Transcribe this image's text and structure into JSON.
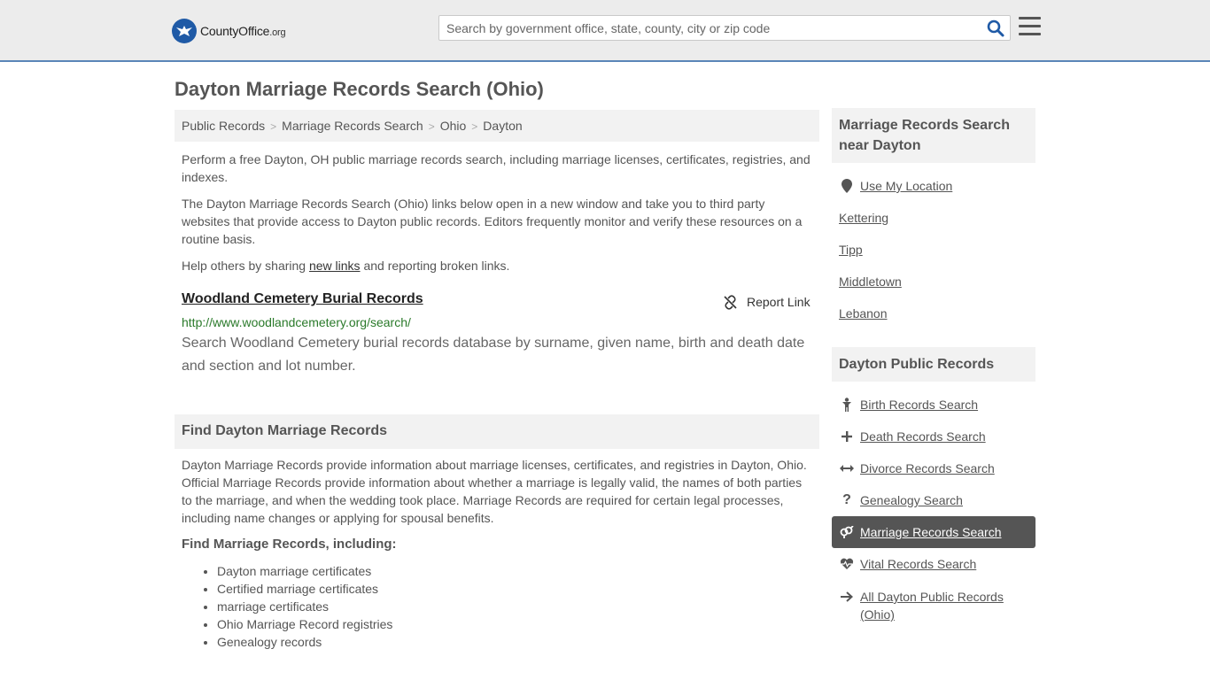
{
  "header": {
    "logo_text": "CountyOffice",
    "logo_org": ".org",
    "search_placeholder": "Search by government office, state, county, city or zip code"
  },
  "page_title": "Dayton Marriage Records Search (Ohio)",
  "breadcrumb": [
    "Public Records",
    "Marriage Records Search",
    "Ohio",
    "Dayton"
  ],
  "intro": {
    "p1": "Perform a free Dayton, OH public marriage records search, including marriage licenses, certificates, registries, and indexes.",
    "p2": "The Dayton Marriage Records Search (Ohio) links below open in a new window and take you to third party websites that provide access to Dayton public records. Editors frequently monitor and verify these resources on a routine basis.",
    "p3_before": "Help others by sharing ",
    "p3_link": "new links",
    "p3_after": " and reporting broken links."
  },
  "resource": {
    "title": "Woodland Cemetery Burial Records",
    "report_label": "Report Link",
    "url": "http://www.woodlandcemetery.org/search/",
    "description": "Search Woodland Cemetery burial records database by surname, given name, birth and death date and section and lot number."
  },
  "find_section": {
    "heading": "Find Dayton Marriage Records",
    "body": "Dayton Marriage Records provide information about marriage licenses, certificates, and registries in Dayton, Ohio. Official Marriage Records provide information about whether a marriage is legally valid, the names of both parties to the marriage, and when the wedding took place. Marriage Records are required for certain legal processes, including name changes or applying for spousal benefits.",
    "subheading": "Find Marriage Records, including:",
    "items": [
      "Dayton marriage certificates",
      "Certified marriage certificates",
      "marriage certificates",
      "Ohio Marriage Record registries",
      "Genealogy records"
    ]
  },
  "sidebar": {
    "near_heading": "Marriage Records Search near Dayton",
    "use_location": "Use My Location",
    "nearby": [
      "Kettering",
      "Tipp",
      "Middletown",
      "Lebanon"
    ],
    "public_heading": "Dayton Public Records",
    "links": [
      {
        "label": "Birth Records Search",
        "icon": "child-icon"
      },
      {
        "label": "Death Records Search",
        "icon": "cross-icon"
      },
      {
        "label": "Divorce Records Search",
        "icon": "arrows-horizontal-icon"
      },
      {
        "label": "Genealogy Search",
        "icon": "question-icon"
      },
      {
        "label": "Marriage Records Search",
        "icon": "marriage-symbol-icon"
      },
      {
        "label": "Vital Records Search",
        "icon": "heartbeat-icon"
      },
      {
        "label": "All Dayton Public Records (Ohio)",
        "icon": "arrow-right-icon"
      }
    ],
    "active_color": "#555555"
  }
}
